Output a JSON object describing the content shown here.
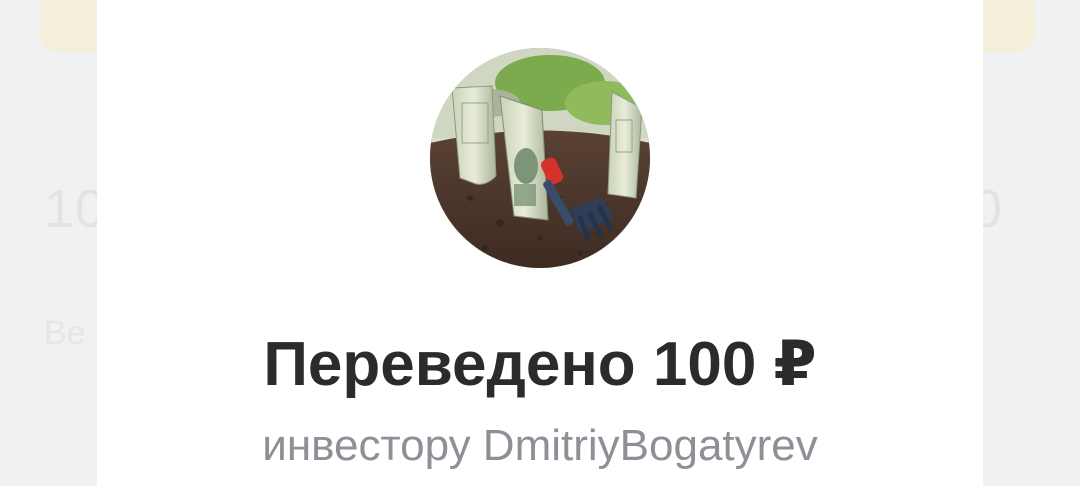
{
  "background_screen": {
    "amount_left_fragment": "10",
    "amount_right_fragment": "0",
    "subtitle_left_fragment": "Be"
  },
  "transfer_result": {
    "avatar_icon": "money-seedling-icon",
    "title": "Переведено 100 ₽",
    "subtitle": "инвестору DmitriyBogatyrev"
  },
  "colors": {
    "title": "#2b2b2d",
    "subtitle": "#8e9097",
    "sheet_background": "#ffffff",
    "background_banner": "#f3efd9"
  }
}
